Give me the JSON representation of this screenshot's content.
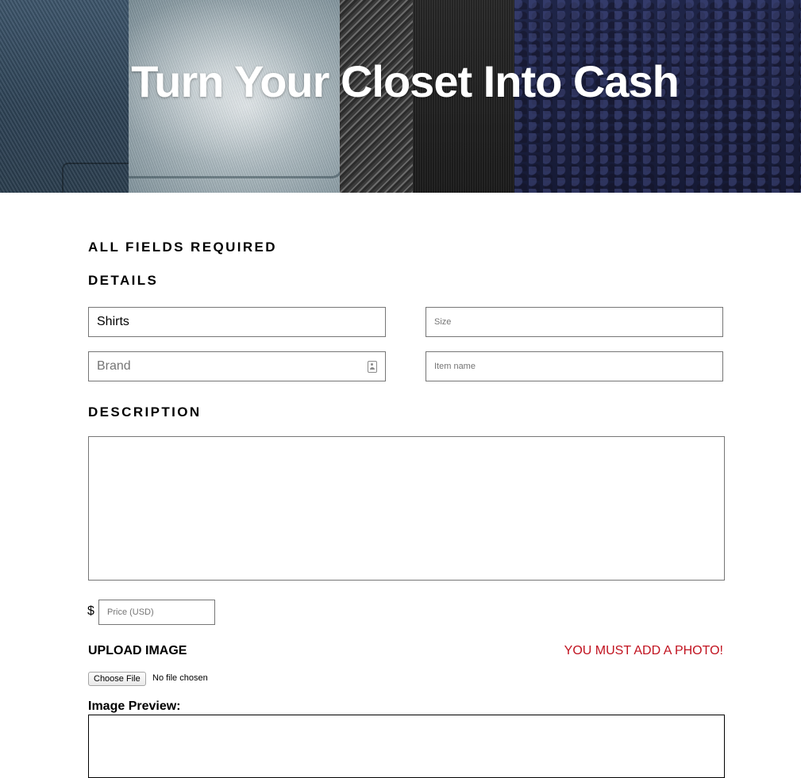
{
  "hero": {
    "title": "Turn Your Closet Into Cash"
  },
  "form": {
    "required_note": "ALL FIELDS REQUIRED",
    "details_heading": "DETAILS",
    "category_value": "Shirts",
    "size_placeholder": "Size",
    "brand_placeholder": "Brand",
    "item_name_placeholder": "Item name",
    "description_heading": "DESCRIPTION",
    "currency_symbol": "$",
    "price_placeholder": "Price (USD)",
    "upload_label": "UPLOAD IMAGE",
    "photo_warning": "YOU MUST ADD A PHOTO!",
    "choose_file_label": "Choose File",
    "no_file_text": "No file chosen",
    "preview_label": "Image Preview:"
  },
  "colors": {
    "warning": "#c1121f",
    "hero_text": "#ffffff"
  },
  "icons": {
    "brand_field_icon": "contact-card-icon"
  }
}
